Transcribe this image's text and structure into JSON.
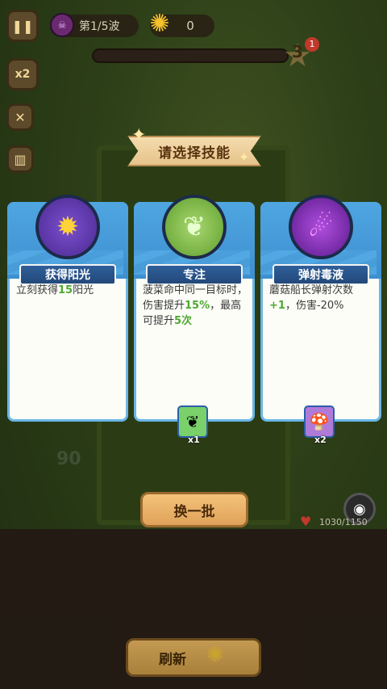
{
  "hud": {
    "pause_icon": "pause-icon",
    "speed_label": "x2",
    "wave_label": "第1/5波",
    "sun_count": "0",
    "level_number": "3",
    "level_badge": "1"
  },
  "dialog": {
    "title": "请选择技能"
  },
  "cards": [
    {
      "name": "获得阳光",
      "icon": "sun-burst-icon",
      "desc_parts": [
        "立刻获得",
        "15",
        "阳光"
      ]
    },
    {
      "name": "专注",
      "icon": "spinach-icon",
      "desc_parts": [
        "菠菜命中同一目标时，伤害提升",
        "15%",
        "，最高可提升",
        "5次"
      ],
      "hero_count": "x1"
    },
    {
      "name": "弹射毒液",
      "icon": "poison-icon",
      "desc_parts": [
        "蘑菇船长弹射次数",
        "+1",
        "，伤害-20%"
      ],
      "hero_count": "x2"
    }
  ],
  "swap_button": "换一批",
  "refresh_button": "刷新",
  "hp_text": "1030/1150",
  "bg_score": "90",
  "colors": {
    "card_border": "#69b6e8",
    "highlight_green": "#4da830",
    "button_orange": "#e0a25a"
  }
}
